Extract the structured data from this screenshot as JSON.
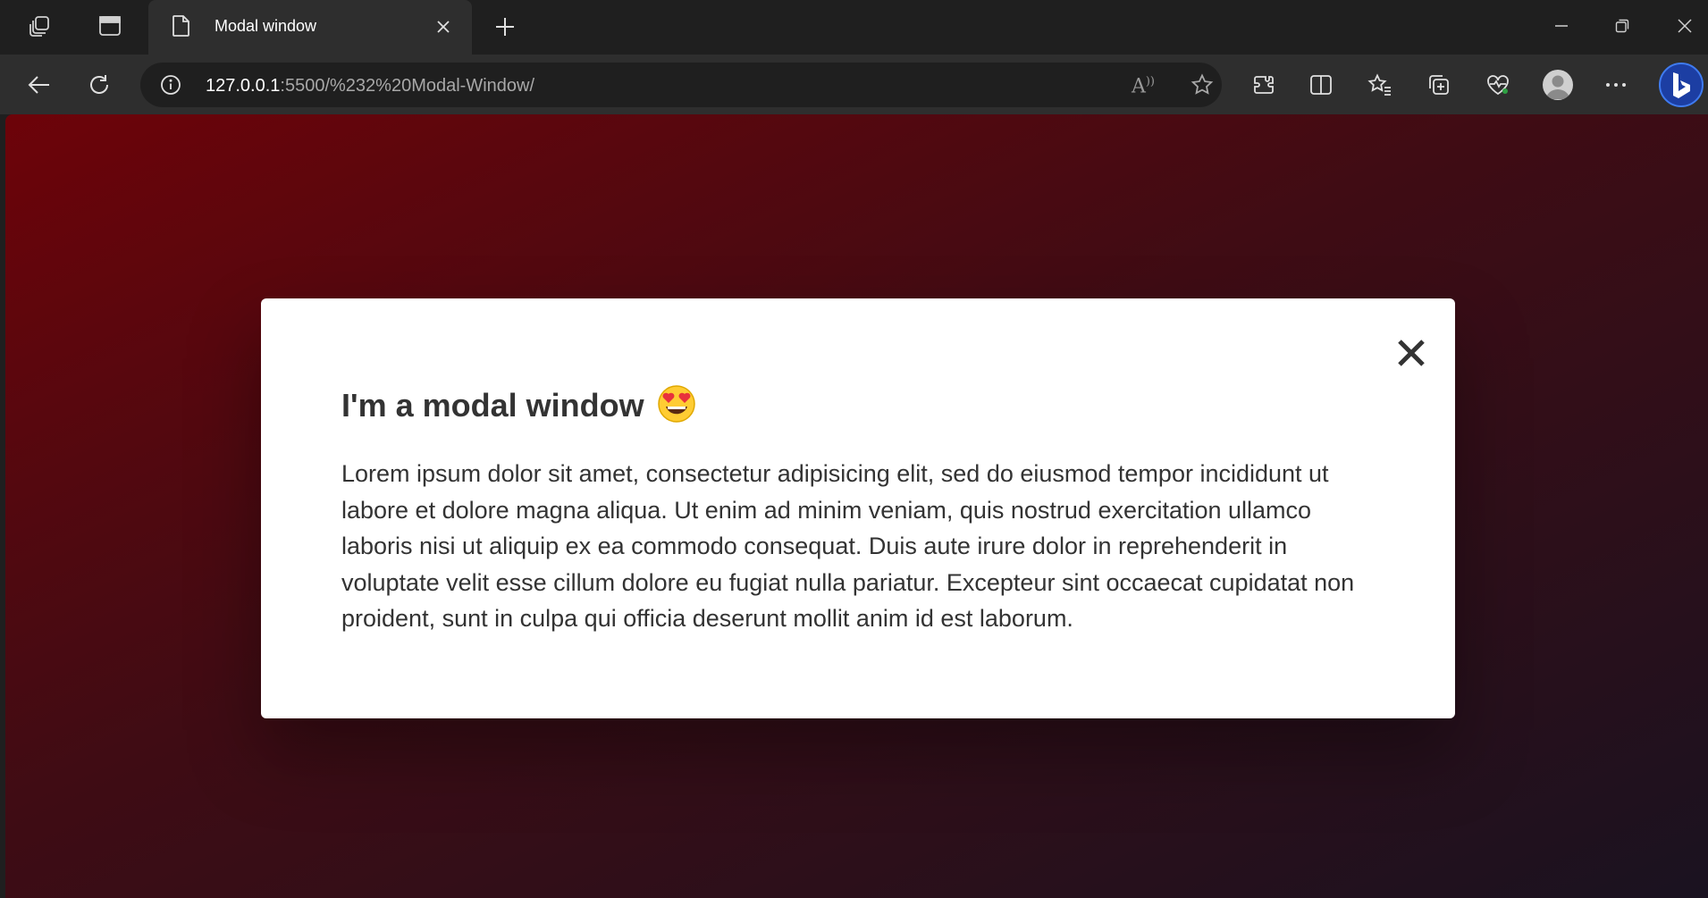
{
  "browser": {
    "tab": {
      "title": "Modal window",
      "close_icon": "close-icon"
    },
    "icons": {
      "workspaces": "workspaces-icon",
      "tab_actions": "tab-actions-icon",
      "new_tab": "plus-icon",
      "minimize": "minimize-icon",
      "restore": "restore-icon",
      "close_window": "close-icon"
    },
    "address_bar": {
      "host": "127.0.0.1",
      "path": ":5500/%232%20Modal-Window/",
      "read_aloud_label": "A"
    },
    "toolbar_icons": [
      "back-icon",
      "refresh-icon",
      "info-icon",
      "read-aloud-icon",
      "favorite-star-icon",
      "extensions-icon",
      "split-screen-icon",
      "favorites-icon",
      "collections-icon",
      "browser-essentials-icon",
      "profile-avatar",
      "more-icon",
      "bing-copilot-icon"
    ]
  },
  "page": {
    "modal": {
      "title": "I'm a modal window",
      "emoji": "heart-eyes-emoji",
      "close_label": "×",
      "body": "Lorem ipsum dolor sit amet, consectetur adipisicing elit, sed do eiusmod tempor incididunt ut labore et dolore magna aliqua. Ut enim ad minim veniam, quis nostrud exercitation ullamco laboris nisi ut aliquip ex ea commodo consequat. Duis aute irure dolor in reprehenderit in voluptate velit esse cillum dolore eu fugiat nulla pariatur. Excepteur sint occaecat cupidatat non proident, sunt in culpa qui officia deserunt mollit anim id est laborum."
    },
    "colors": {
      "background_start": "#6d0309",
      "background_end": "#1a1220",
      "modal_bg": "#ffffff",
      "text": "#333333"
    }
  }
}
